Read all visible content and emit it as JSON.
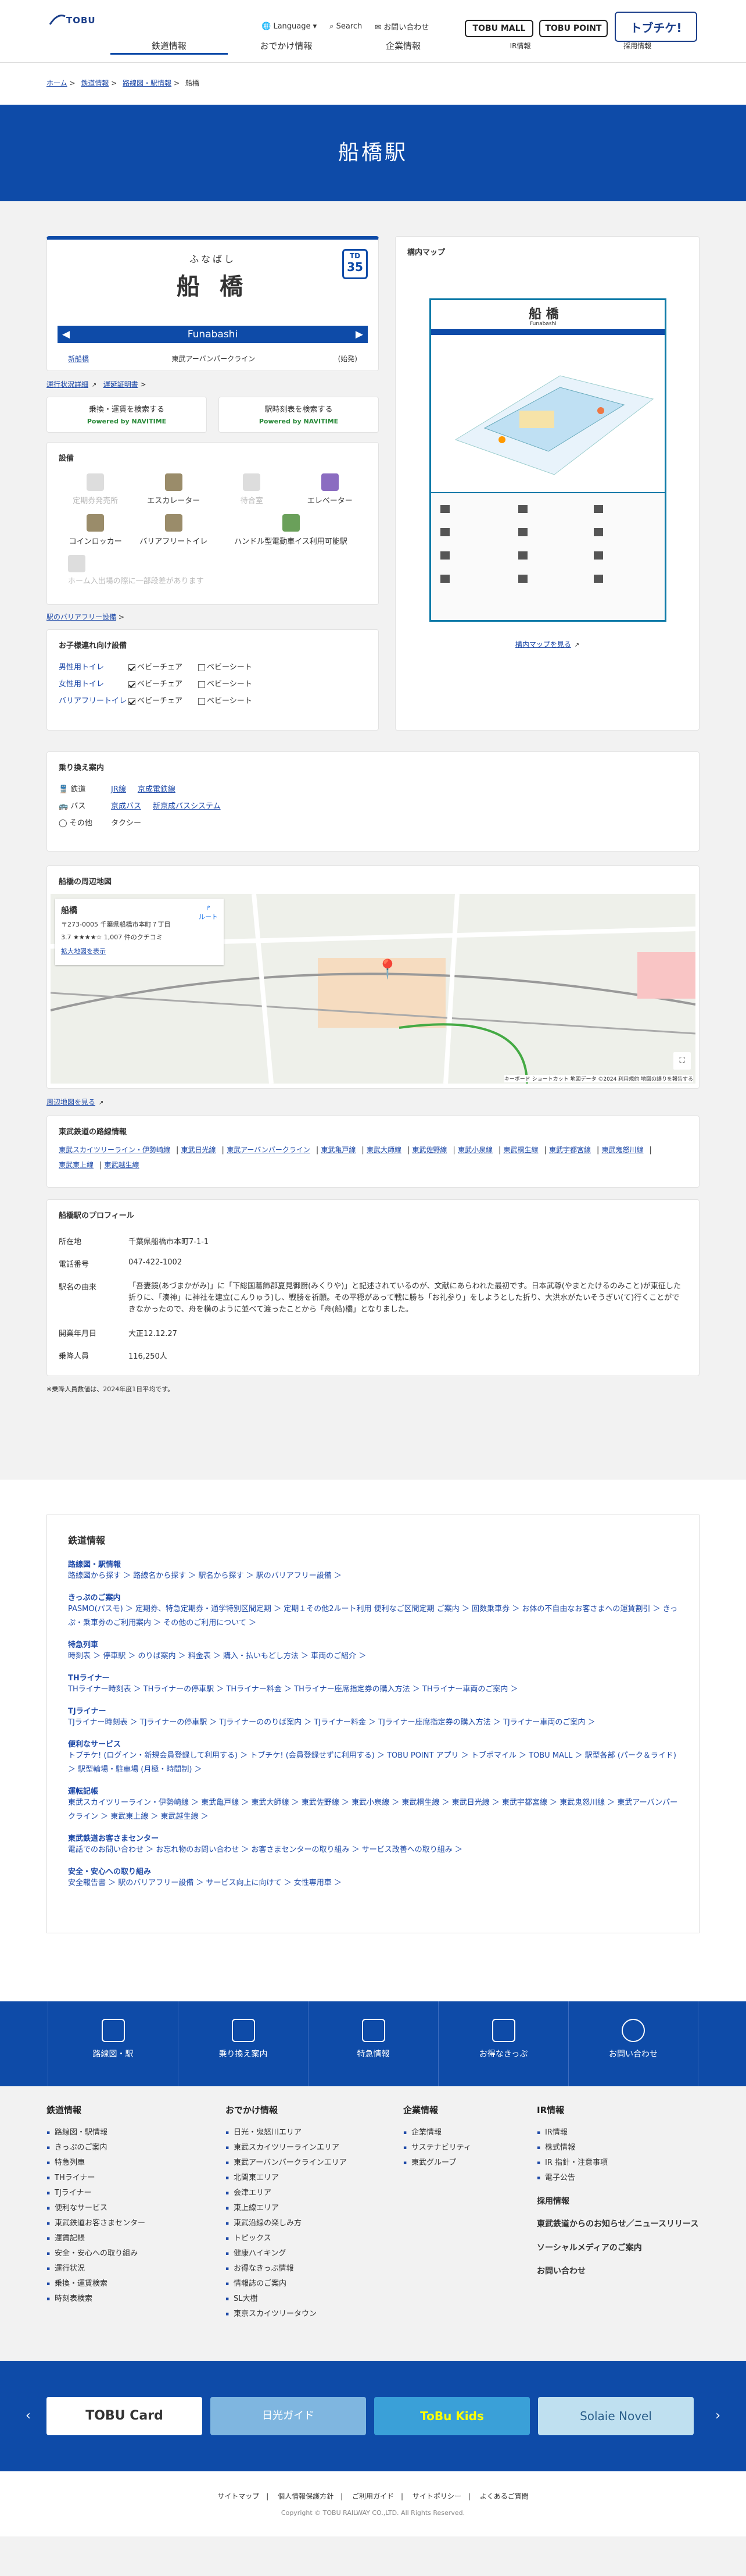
{
  "header": {
    "logo": "TOBU",
    "util": {
      "language": "Language",
      "search": "Search",
      "contact": "お問い合わせ"
    },
    "brand": {
      "mall": "TOBU MALL",
      "point": "TOBU POINT",
      "tobuchiku": "トブチケ!"
    },
    "gnav": [
      "鉄道情報",
      "おでかけ情報",
      "企業情報",
      "IR情報",
      "採用情報"
    ]
  },
  "breadcrumb": [
    "ホーム",
    "鉄道情報",
    "路線図・駅情報",
    "船橋"
  ],
  "page_title": "船橋駅",
  "station": {
    "kana": "ふなばし",
    "kanji": "船 橋",
    "roman": "Funabashi",
    "number_top": "TD",
    "number": "35",
    "prev": "新船橋",
    "line": "東武アーバンパークライン",
    "next": "(始発)"
  },
  "links_top": {
    "status": "運行状況詳細",
    "delay": "遅延証明書"
  },
  "navitime": {
    "s1": "乗換・運賃を検索する",
    "s2": "駅時刻表を検索する",
    "powered": "Powered by NAVITIME"
  },
  "facilities": {
    "title": "設備",
    "items": [
      {
        "label": "定期券発売所",
        "on": false
      },
      {
        "label": "エスカレーター",
        "on": true
      },
      {
        "label": "待合室",
        "on": false
      },
      {
        "label": "エレベーター",
        "on": true
      },
      {
        "label": "コインロッカー",
        "on": true
      },
      {
        "label": "バリアフリートイレ",
        "on": true
      },
      {
        "label": "ハンドル型電動車イス利用可能駅",
        "on": true
      },
      {
        "label": "",
        "on": false
      },
      {
        "label": "ホーム入出場の際に一部段差があります",
        "on": false
      }
    ],
    "bf_link": "駅のバリアフリー設備"
  },
  "toilet": {
    "title": "お子様連れ向け設備",
    "rows": [
      {
        "name": "男性用トイレ",
        "a": "ベビーチェア",
        "b": "ベビーシート"
      },
      {
        "name": "女性用トイレ",
        "a": "ベビーチェア",
        "b": "ベビーシート"
      },
      {
        "name": "バリアフリートイレ",
        "a": "ベビーチェア",
        "b": "ベビーシート"
      }
    ]
  },
  "premises": {
    "title": "構内マップ",
    "map_title": "船 橋",
    "map_roman": "Funabashi",
    "map_kana": "ふなばし",
    "more": "構内マップを見る"
  },
  "transfer": {
    "title": "乗り換え案内",
    "rows": [
      {
        "type": "鉄道",
        "links": [
          "JR線",
          "京成電鉄線"
        ]
      },
      {
        "type": "バス",
        "links": [
          "京成バス",
          "新京成バスシステム"
        ]
      },
      {
        "type": "その他",
        "links": [
          "タクシー"
        ]
      }
    ]
  },
  "area_map": {
    "title": "船橋の周辺地図",
    "name": "船橋",
    "addr": "〒273-0005 千葉県船橋市本町７丁目",
    "rating": "3.7 ★★★★☆ 1,007 件のクチコミ",
    "larger": "拡大地図を表示",
    "route": "ルート",
    "more": "周辺地図を見る",
    "credit": "キーボード ショートカット 地図データ ©2024 利用規約 地図の誤りを報告する"
  },
  "lines": {
    "title": "東武鉄道の路線情報",
    "items": [
      "東武スカイツリーライン・伊勢崎線",
      "東武日光線",
      "東武アーバンパークライン",
      "東武亀戸線",
      "東武大師線",
      "東武佐野線",
      "東武小泉線",
      "東武桐生線",
      "東武宇都宮線",
      "東武鬼怒川線",
      "東武東上線",
      "東武越生線"
    ]
  },
  "profile": {
    "title": "船橋駅のプロフィール",
    "rows": [
      {
        "k": "所在地",
        "v": "千葉県船橋市本町7-1-1"
      },
      {
        "k": "電話番号",
        "v": "047-422-1002"
      },
      {
        "k": "駅名の由来",
        "v": "「吾妻鏡(あづまかがみ)」に「下総国葛飾郡夏見御厨(みくりや)」と記述されているのが、文献にあらわれた最初です。日本武尊(やまとたけるのみこと)が東征した折りに、「湊神」に神社を建立(こんりゅう)し、戦勝を祈願。その平穏があって戦に勝ち「お礼参り」をしようとした折り、大洪水がたいそうぎい(て)行くことができなかったので、舟を横のように並べて渡ったことから「舟(船)橋」となりました。"
      },
      {
        "k": "開業年月日",
        "v": "大正12.12.27"
      },
      {
        "k": "乗降人員",
        "v": "116,250人"
      }
    ],
    "note": "※乗降人員数値は、2024年度1日平均です。"
  },
  "rail_info": {
    "title": "鉄道情報",
    "groups": [
      {
        "h": "路線図・駅情報",
        "items": "路線図から探す ＞ 路線名から探す ＞ 駅名から探す ＞ 駅のバリアフリー設備 ＞"
      },
      {
        "h": "きっぷのご案内",
        "items": "PASMO(パスモ) ＞ 定期券、特急定期券・通学特別区間定期 ＞ 定期１その他2ルート利用 便利なご区間定期 ご案内 ＞ 回数乗車券 ＞ お体の不自由なお客さまへの運賃割引 ＞ きっぷ・乗車券のご利用案内 ＞ その他のご利用について ＞"
      },
      {
        "h": "特急列車",
        "items": "時刻表 ＞ 停車駅 ＞ のりば案内 ＞ 料金表 ＞ 購入・払いもどし方法 ＞ 車両のご紹介 ＞"
      },
      {
        "h": "THライナー",
        "items": "THライナー時刻表 ＞ THライナーの停車駅 ＞ THライナー料金 ＞ THライナー座席指定券の購入方法 ＞ THライナー車両のご案内 ＞"
      },
      {
        "h": "TJライナー",
        "items": "TJライナー時刻表 ＞ TJライナーの停車駅 ＞ TJライナーののりば案内 ＞ TJライナー料金 ＞ TJライナー座席指定券の購入方法 ＞ TJライナー車両のご案内 ＞"
      },
      {
        "h": "便利なサービス",
        "items": "トブチケ! (ログイン・新規会員登録して利用する) ＞ トブチケ! (会員登録せずに利用する) ＞ TOBU POINT アプリ ＞ トブポマイル ＞ TOBU MALL ＞ 駅型各部 (パーク＆ライド) ＞ 駅型輪場・駐車場 (月極・時間制) ＞"
      },
      {
        "h": "運転記帳",
        "items": "東武スカイツリーライン・伊勢崎線 ＞ 東武亀戸線 ＞ 東武大師線 ＞ 東武佐野線 ＞ 東武小泉線 ＞ 東武桐生線 ＞ 東武日光線 ＞ 東武宇都宮線 ＞ 東武鬼怒川線 ＞ 東武アーバンパークライン ＞ 東武東上線 ＞ 東武越生線 ＞"
      },
      {
        "h": "東武鉄道お客さまセンター",
        "items": "電話でのお問い合わせ ＞ お忘れ物のお問い合わせ ＞ お客さまセンターの取り組み ＞ サービス改善への取り組み ＞"
      },
      {
        "h": "安全・安心への取り組み",
        "items": "安全報告書 ＞ 駅のバリアフリー設備 ＞ サービス向上に向けて ＞ 女性専用車 ＞"
      }
    ]
  },
  "footer_menu": [
    "路線図・駅",
    "乗り換え案内",
    "特急情報",
    "お得なきっぷ",
    "お問い合わせ"
  ],
  "sitemap": {
    "c1": {
      "h": "鉄道情報",
      "items": [
        "路線図・駅情報",
        "きっぷのご案内",
        "特急列車",
        "THライナー",
        "TJライナー",
        "便利なサービス",
        "東武鉄道お客さまセンター",
        "運賃記帳",
        "安全・安心への取り組み",
        "運行状況",
        "乗換・運賃検索",
        "時刻表検索"
      ]
    },
    "c2": {
      "h": "おでかけ情報",
      "items": [
        "日光・鬼怒川エリア",
        "東武スカイツリーラインエリア",
        "東武アーバンパークラインエリア",
        "北関東エリア",
        "会津エリア",
        "東上線エリア",
        "東武沿線の楽しみ方",
        "トピックス",
        "健康ハイキング",
        "お得なきっぷ情報",
        "情報誌のご案内",
        "SL大樹",
        "東京スカイツリータウン"
      ]
    },
    "c3": {
      "h": "企業情報",
      "items": [
        "企業情報",
        "サステナビリティ",
        "東武グループ"
      ]
    },
    "c4": {
      "h": "IR情報",
      "items": [
        "IR情報",
        "株式情報",
        "IR 指針・注意事項",
        "電子公告"
      ],
      "extra": [
        "採用情報",
        "東武鉄道からのお知らせ／ニュースリリース",
        "ソーシャルメディアのご案内",
        "お問い合わせ"
      ]
    }
  },
  "banners": [
    "TOBU Card",
    "日光ガイド",
    "ToBu Kids",
    "Solaie Novel"
  ],
  "bottom": {
    "links": [
      "サイトマップ",
      "個人情報保護方針",
      "ご利用ガイド",
      "サイトポリシー",
      "よくあるご質問"
    ],
    "copy": "Copyright © TOBU RAILWAY CO.,LTD. All Rights Reserved."
  }
}
